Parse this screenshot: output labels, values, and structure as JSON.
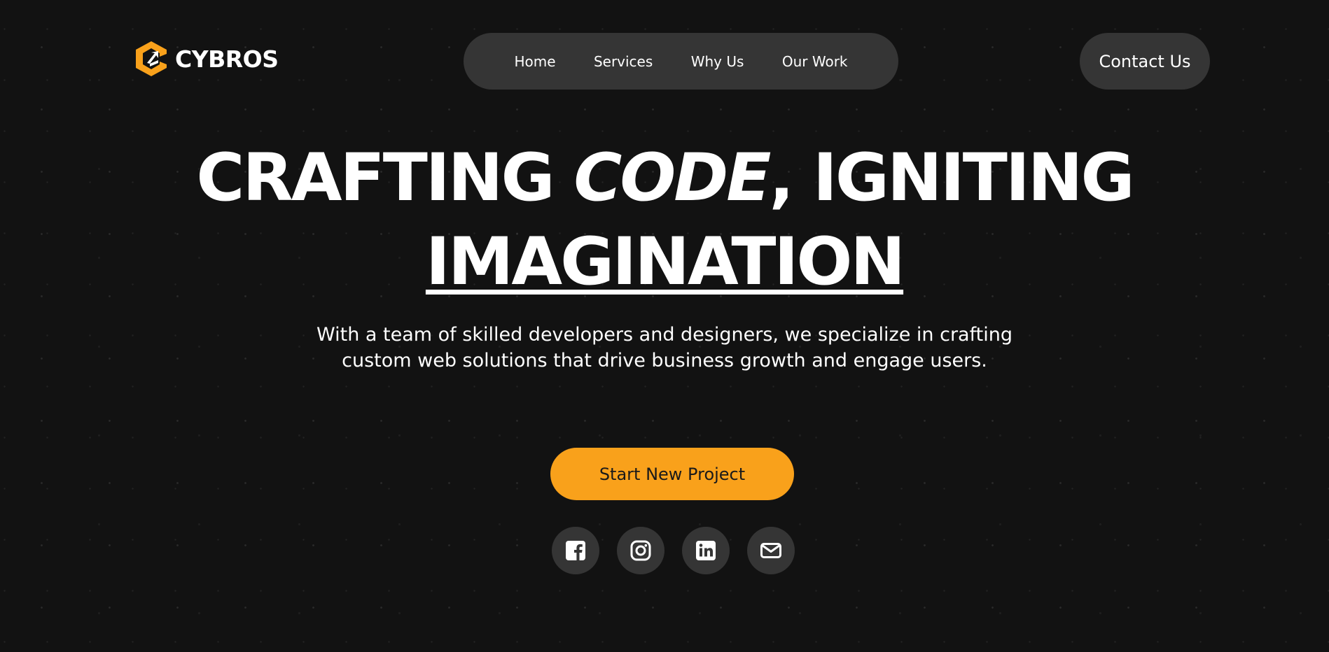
{
  "brand": {
    "name": "CYBROS",
    "logo_icon": "hexagon-arrow-logo-icon",
    "accent_color": "#f9a11b"
  },
  "nav": {
    "items": [
      {
        "label": "Home"
      },
      {
        "label": "Services"
      },
      {
        "label": "Why Us"
      },
      {
        "label": "Our Work"
      }
    ]
  },
  "header": {
    "contact_label": "Contact Us"
  },
  "hero": {
    "title_part1": "CRAFTING ",
    "title_emphasis": "CODE",
    "title_part2": ", IGNITING",
    "title_line2": "IMAGINATION",
    "description": "With a team of skilled developers and designers, we specialize in crafting custom web solutions that drive business growth and engage users.",
    "cta_label": "Start New Project"
  },
  "social": {
    "icons": [
      "facebook-icon",
      "instagram-icon",
      "linkedin-icon",
      "email-icon"
    ]
  },
  "colors": {
    "background": "#121212",
    "pill": "#353535",
    "text": "#ffffff",
    "accent": "#f9a11b"
  }
}
